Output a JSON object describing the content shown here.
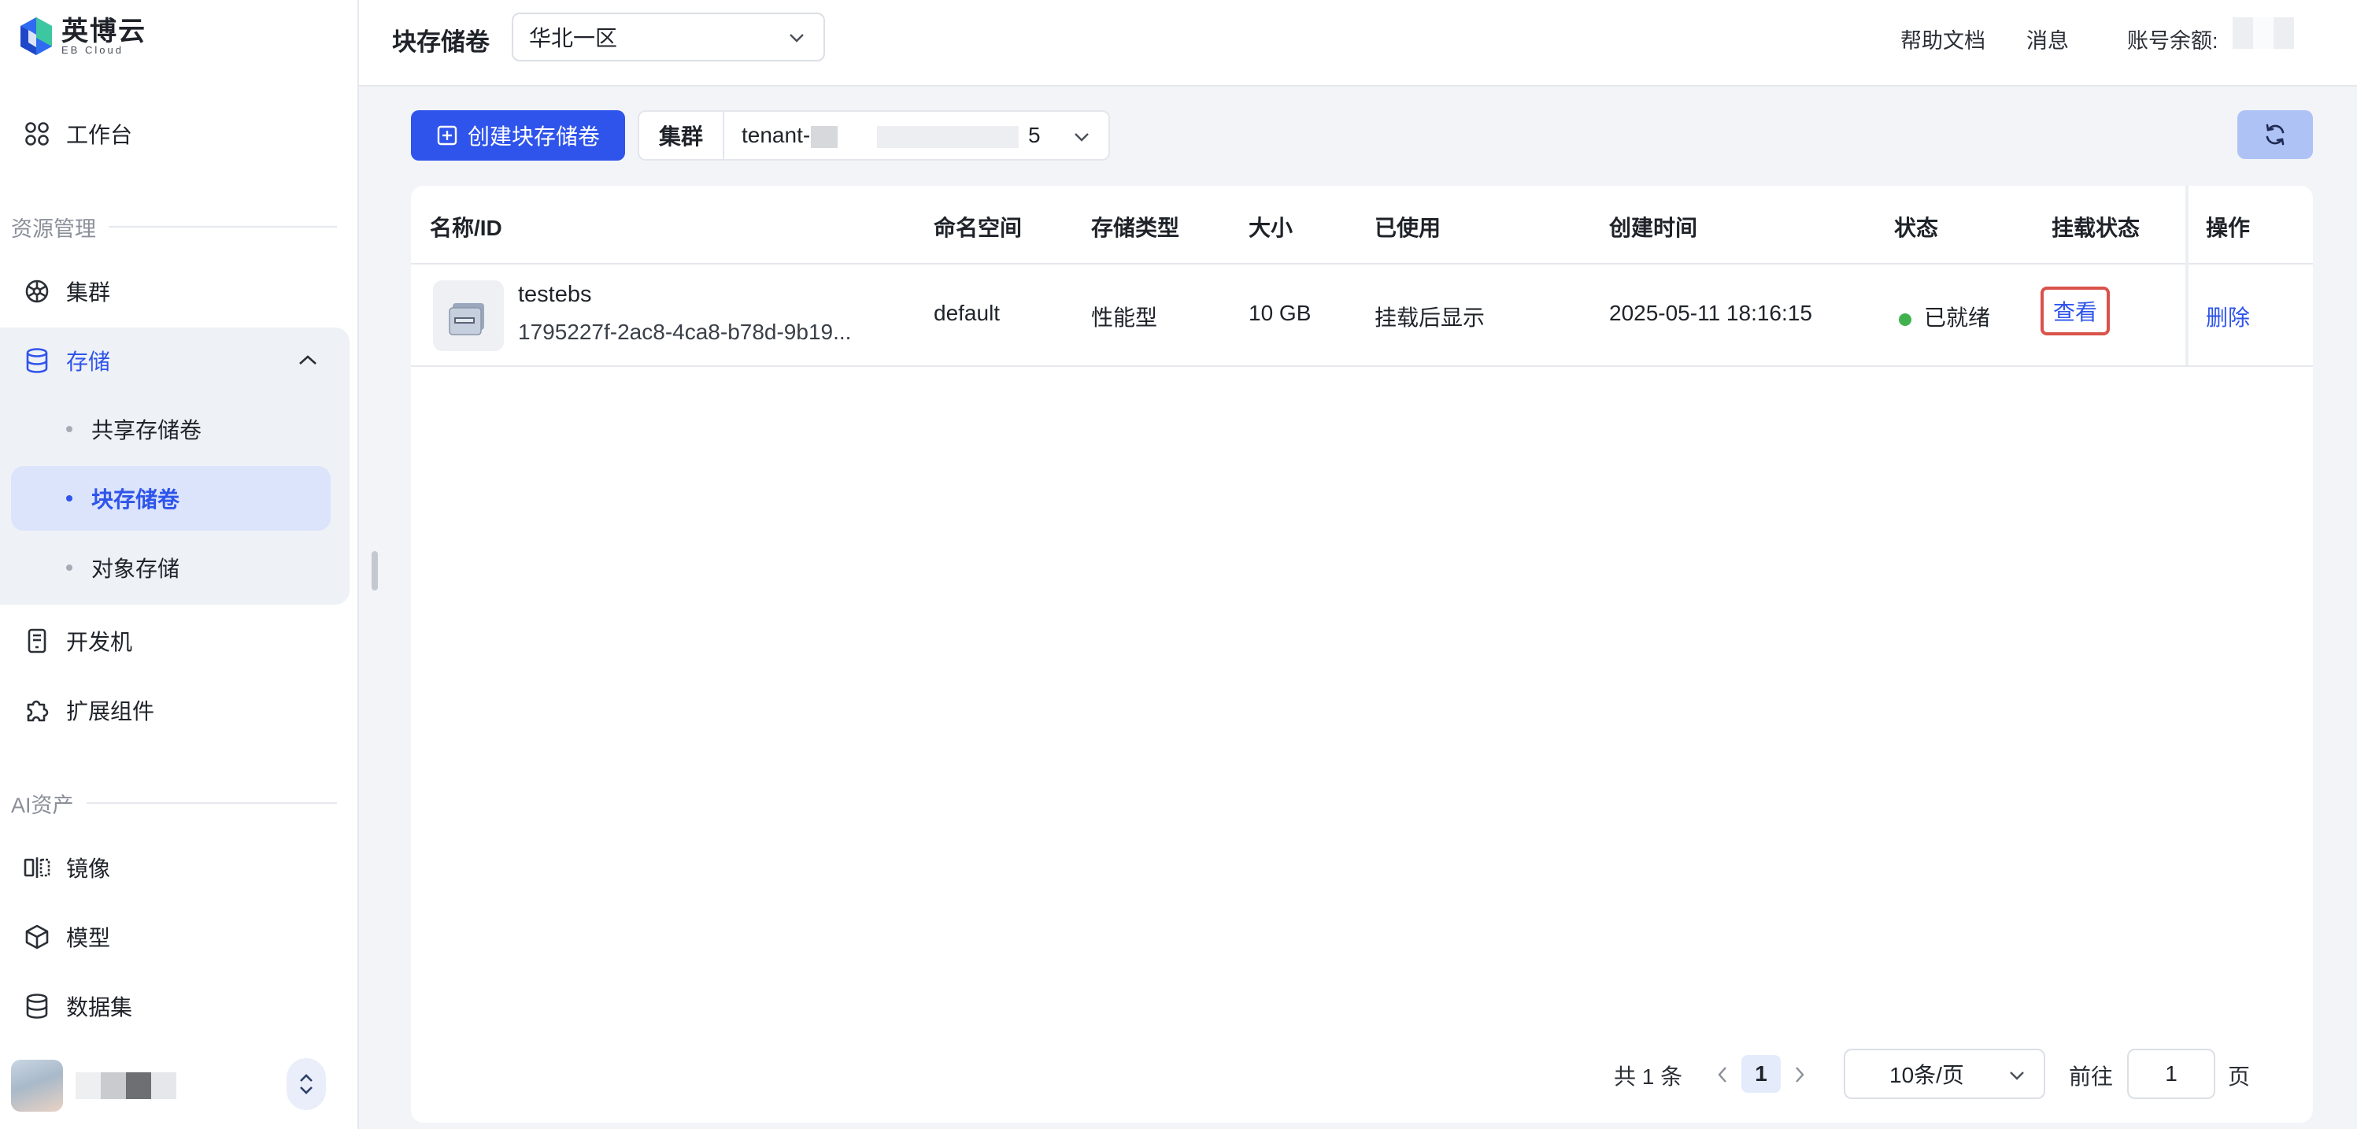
{
  "brand": {
    "name_cn": "英博云",
    "name_en": "EB Cloud"
  },
  "header": {
    "title": "块存储卷",
    "region": "华北一区",
    "links": {
      "help": "帮助文档",
      "messages": "消息",
      "balance": "账号余额:"
    }
  },
  "sidebar": {
    "workbench": "工作台",
    "resource_section": "资源管理",
    "cluster": "集群",
    "storage": "存储",
    "storage_children": {
      "shared": "共享存储卷",
      "block": "块存储卷",
      "object": "对象存储"
    },
    "devbox": "开发机",
    "extensions": "扩展组件",
    "ai_section": "AI资产",
    "image": "镜像",
    "model": "模型",
    "dataset": "数据集"
  },
  "toolbar": {
    "create_label": "创建块存储卷",
    "cluster_tag": "集群",
    "cluster_prefix": "tenant-",
    "cluster_suffix": "5"
  },
  "table": {
    "columns": {
      "name": "名称/ID",
      "namespace": "命名空间",
      "type": "存储类型",
      "size": "大小",
      "used": "已使用",
      "created": "创建时间",
      "status": "状态",
      "mount": "挂载状态",
      "ops": "操作"
    },
    "rows": [
      {
        "name": "testebs",
        "id": "1795227f-2ac8-4ca8-b78d-9b19...",
        "namespace": "default",
        "type": "性能型",
        "size": "10 GB",
        "used": "挂载后显示",
        "created": "2025-05-11 18:16:15",
        "status": "已就绪",
        "mount_action": "查看",
        "op_action": "删除"
      }
    ]
  },
  "pagination": {
    "total": "共 1 条",
    "current_page": "1",
    "page_size": "10条/页",
    "goto_label": "前往",
    "goto_value": "1",
    "page_unit": "页"
  },
  "colors": {
    "primary": "#2f54eb",
    "ready": "#3fb24e",
    "highlight": "#d9534a"
  }
}
